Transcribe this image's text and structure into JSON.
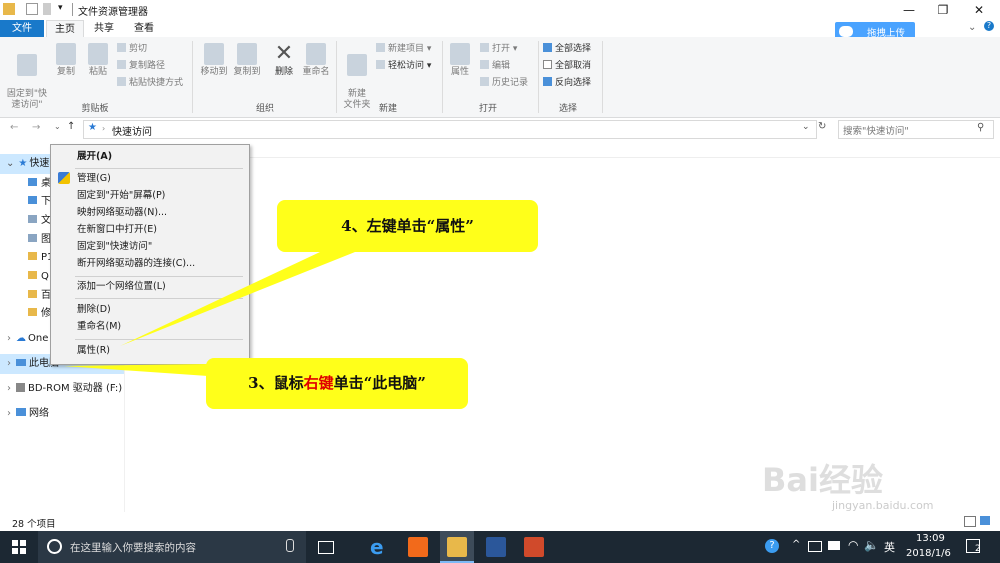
{
  "window": {
    "title": "文件资源管理器"
  },
  "tabs": [
    "文件",
    "主页",
    "共享",
    "查看"
  ],
  "upload_button": "拖拽上传",
  "ribbon": {
    "clipboard": {
      "pin_quick": "固定到\"快\n速访问\"",
      "copy": "复制",
      "paste": "粘贴",
      "cut": "剪切",
      "copy_path": "复制路径",
      "paste_shortcut": "粘贴快捷方式",
      "group": "剪贴板"
    },
    "organize": {
      "move_to": "移动到",
      "copy_to": "复制到",
      "delete": "删除",
      "rename": "重命名",
      "group": "组织"
    },
    "new": {
      "new_folder": "新建\n文件夹",
      "new_item": "新建项目",
      "easy_access": "轻松访问",
      "group": "新建"
    },
    "open": {
      "properties": "属性",
      "open": "打开",
      "edit": "编辑",
      "history": "历史记录",
      "group": "打开"
    },
    "select": {
      "select_all": "全部选择",
      "select_none": "全部取消",
      "invert": "反向选择",
      "group": "选择"
    }
  },
  "address": {
    "path": "快速访问",
    "search_placeholder": "搜索\"快速访问\""
  },
  "nav": {
    "quick_access": "快速",
    "items": [
      "桌",
      "下",
      "文",
      "图",
      "P1",
      "Q",
      "百",
      "修"
    ],
    "onedrive": "One",
    "this_pc": "此电脑",
    "bdrom": "BD-ROM 驱动器 (F:)",
    "network": "网络"
  },
  "context_menu": {
    "expand": "展开(A)",
    "manage": "管理(G)",
    "pin_start": "固定到\"开始\"屏幕(P)",
    "map_drive": "映射网络驱动器(N)...",
    "open_new_window": "在新窗口中打开(E)",
    "pin_quick": "固定到\"快速访问\"",
    "disconnect": "断开网络驱动器的连接(C)...",
    "add_network_location": "添加一个网络位置(L)",
    "delete": "删除(D)",
    "rename": "重命名(M)",
    "properties": "属性(R)"
  },
  "callouts": {
    "step4": "4、左键单击“属性”",
    "step3_prefix": "3、鼠标",
    "step3_highlight": "右键",
    "step3_suffix": "单击“此电脑”"
  },
  "status": {
    "count": "28 个项目"
  },
  "taskbar": {
    "search_placeholder": "在这里输入你要搜索的内容",
    "ime": "英",
    "time": "13:09",
    "date": "2018/1/6",
    "notifications": "2"
  },
  "watermark": {
    "line1": "Bai经验",
    "line2": "jingyan.baidu.com"
  },
  "colors": {
    "file_tab": "#1979ca",
    "callout": "#ffff1a",
    "highlight_red": "#e00000",
    "taskbar": "#1c2833"
  }
}
